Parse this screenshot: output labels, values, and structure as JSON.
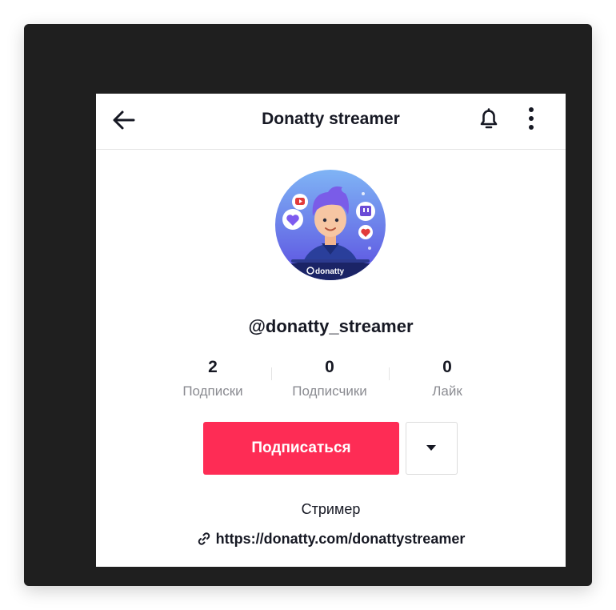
{
  "header": {
    "title": "Donatty streamer"
  },
  "profile": {
    "handle": "@donatty_streamer",
    "avatar_brand_text": "donatty",
    "stats": [
      {
        "value": "2",
        "label": "Подписки"
      },
      {
        "value": "0",
        "label": "Подписчики"
      },
      {
        "value": "0",
        "label": "Лайк"
      }
    ],
    "follow_label": "Подписаться",
    "bio": "Стример",
    "link": "https://donatty.com/donattystreamer"
  },
  "icons": {
    "back": "arrow-left-icon",
    "notifications": "bell-icon",
    "more": "more-vertical-icon",
    "dropdown": "caret-down-icon",
    "link": "link-icon"
  },
  "colors": {
    "accent": "#fe2c55",
    "frame": "#1f1f1f",
    "text": "#161823",
    "muted": "#8a8b91"
  }
}
